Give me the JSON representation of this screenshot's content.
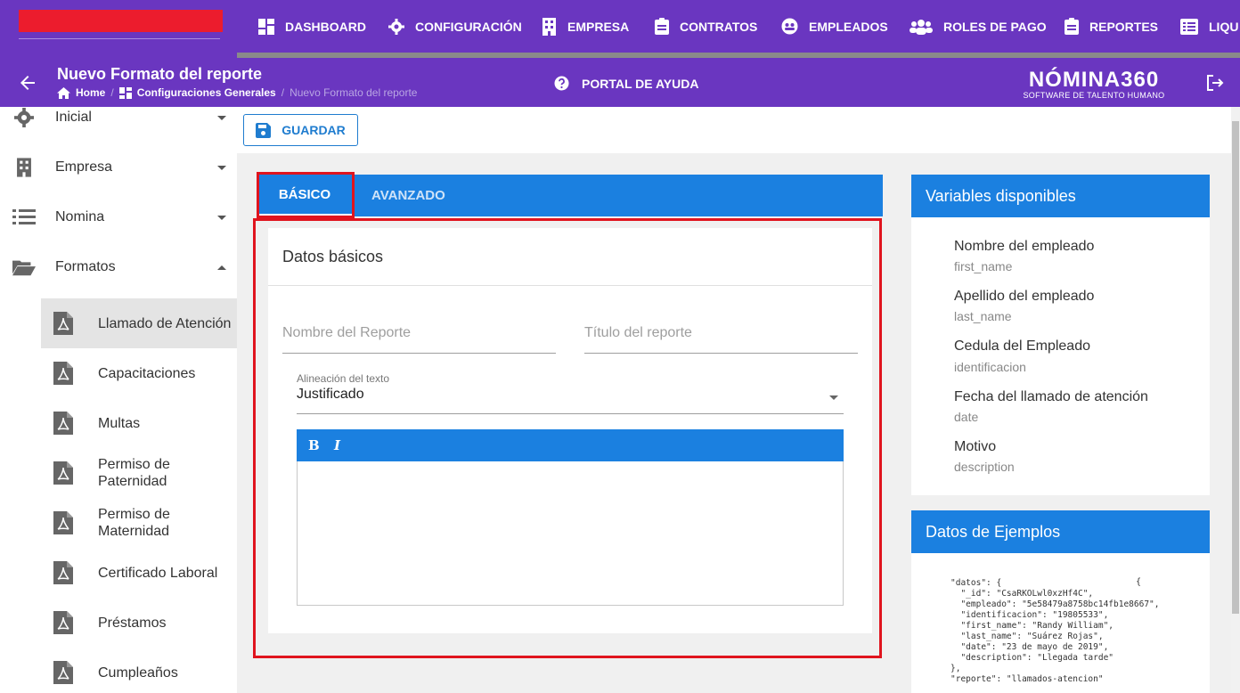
{
  "nav": {
    "items": [
      {
        "label": "DASHBOARD",
        "icon": "dashboard-icon"
      },
      {
        "label": "CONFIGURACIÓN",
        "icon": "gear-icon"
      },
      {
        "label": "EMPRESA",
        "icon": "building-icon"
      },
      {
        "label": "CONTRATOS",
        "icon": "clipboard-icon"
      },
      {
        "label": "EMPLEADOS",
        "icon": "people-circle-icon"
      },
      {
        "label": "ROLES DE PAGO",
        "icon": "group-icon"
      },
      {
        "label": "REPORTES",
        "icon": "clipboard-icon"
      },
      {
        "label": "LIQU",
        "icon": "list-icon"
      }
    ],
    "brand_color": "#6a36c0",
    "logo_color": "#ec1c2d"
  },
  "header": {
    "title": "Nuevo Formato del reporte",
    "breadcrumb": {
      "home": "Home",
      "section": "Configuraciones Generales",
      "current": "Nuevo Formato del reporte",
      "separator": "/"
    },
    "help": "PORTAL DE AYUDA",
    "brand_name": "NÓMINA360",
    "brand_tagline": "SOFTWARE DE TALENTO HUMANO"
  },
  "sidebar": {
    "items": [
      {
        "label": "Inicial",
        "icon": "gear-icon"
      },
      {
        "label": "Empresa",
        "icon": "building-icon"
      },
      {
        "label": "Nomina",
        "icon": "list-icon"
      },
      {
        "label": "Formatos",
        "icon": "folder-open-icon"
      }
    ],
    "subitems": [
      {
        "label": "Llamado de Atención",
        "active": true
      },
      {
        "label": "Capacitaciones"
      },
      {
        "label": "Multas"
      },
      {
        "label": "Permiso de Paternidad"
      },
      {
        "label": "Permiso de Maternidad"
      },
      {
        "label": "Certificado Laboral"
      },
      {
        "label": "Préstamos"
      },
      {
        "label": "Cumpleaños"
      }
    ]
  },
  "toolbar": {
    "save_label": "GUARDAR"
  },
  "tabs": [
    {
      "label": "BÁSICO",
      "active": true
    },
    {
      "label": "AVANZADO",
      "active": false
    }
  ],
  "form": {
    "section_title": "Datos básicos",
    "report_name_placeholder": "Nombre del Reporte",
    "report_title_placeholder": "Título del reporte",
    "alignment_label": "Alineación del texto",
    "alignment_value": "Justificado",
    "editor_bold": "B",
    "editor_italic": "I"
  },
  "variables": {
    "title": "Variables disponibles",
    "items": [
      {
        "name": "Nombre del empleado",
        "key": "first_name"
      },
      {
        "name": "Apellido del empleado",
        "key": "last_name"
      },
      {
        "name": "Cedula del Empleado",
        "key": "identificacion"
      },
      {
        "name": "Fecha del llamado de atención",
        "key": "date"
      },
      {
        "name": "Motivo",
        "key": "description"
      }
    ]
  },
  "examples": {
    "title": "Datos de Ejemplos",
    "open_brace": "{",
    "code": "\"datos\": {\n  \"_id\": \"CsaRKOLwl0xzHf4C\",\n  \"empleado\": \"5e58479a8758bc14fb1e8667\",\n  \"identificacion\": \"19805533\",\n  \"first_name\": \"Randy William\",\n  \"last_name\": \"Suárez Rojas\",\n  \"date\": \"23 de mayo de 2019\",\n  \"description\": \"Llegada tarde\"\n},\n\"reporte\": \"llamados-atencion\""
  },
  "colors": {
    "accent": "#1b80e0",
    "highlight": "#e0141e"
  }
}
